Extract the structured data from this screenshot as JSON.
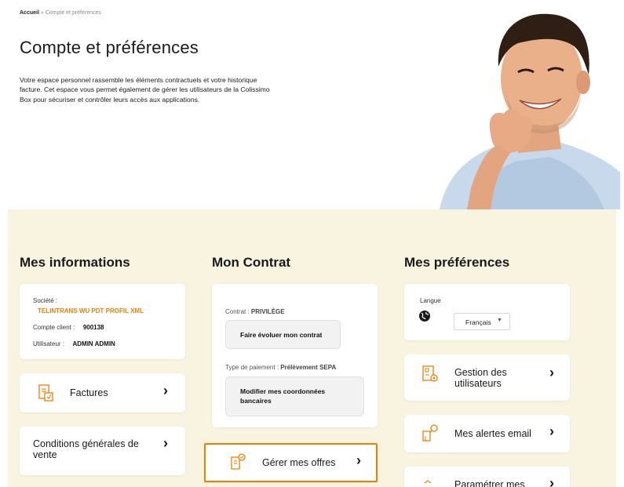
{
  "breadcrumb": {
    "home": "Accueil",
    "separator": " » ",
    "current": "Compte et préférences"
  },
  "header": {
    "title": "Compte et préférences",
    "intro": "Votre espace personnel rassemble les éléments contractuels et votre historique facture. Cet espace vous permet également de gérer les utilisateurs de la Colissimo Box pour sécuriser et contrôler leurs accès aux applications."
  },
  "infos": {
    "title": "Mes informations",
    "societe_label": "Société :",
    "societe_value": "TELINTRANS WU PDT PROFIL XML",
    "compte_label": "Compte client :",
    "compte_value": "900138",
    "utilisateur_label": "Utilisateur :",
    "utilisateur_value": "ADMIN ADMIN",
    "factures_label": "Factures",
    "cgv_label": "Conditions générales de vente"
  },
  "contrat": {
    "title": "Mon Contrat",
    "contrat_label": "Contrat : ",
    "contrat_value": "PRIVILÈGE",
    "faire_evoluer": "Faire évoluer mon contrat",
    "paiement_label": "Type de paiement : ",
    "paiement_value": "Prélèvement SEPA",
    "modifier_coord": "Modifier mes coordonnées bancaires",
    "gerer_offres": "Gérer mes offres"
  },
  "preferences": {
    "title": "Mes préférences",
    "langue_label": "Langue",
    "langue_value": "Français",
    "gestion_users": "Gestion des utilisateurs",
    "alertes_email": "Mes alertes email",
    "parametrer": "Paramétrer mes"
  },
  "colors": {
    "accent": "#f07d00",
    "panel_bg": "#f8f4e0"
  },
  "icons": {
    "chevron": "chevron-right-icon",
    "globe": "globe-icon",
    "invoice": "invoice-icon",
    "users": "user-management-icon",
    "bell": "alert-bell-icon",
    "offers": "offers-document-icon",
    "settings": "settings-icon"
  }
}
